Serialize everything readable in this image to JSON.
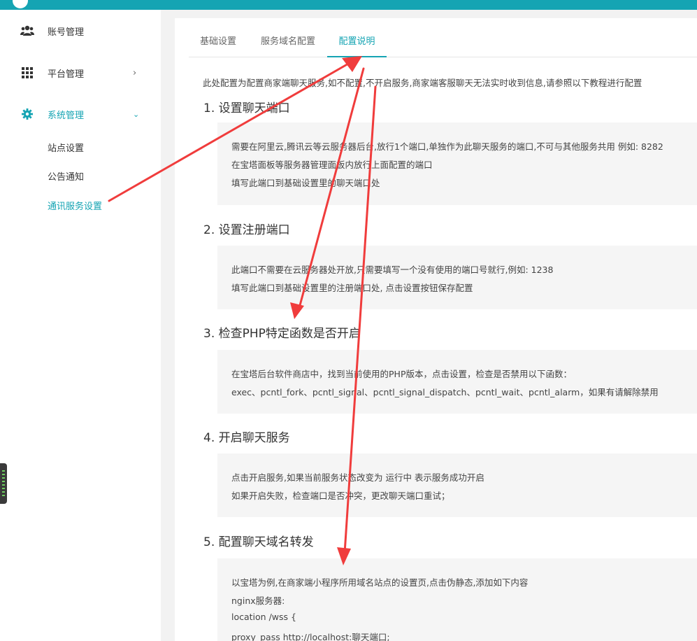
{
  "sidebar": {
    "items": [
      {
        "label": "账号管理",
        "icon": "users-icon"
      },
      {
        "label": "平台管理",
        "icon": "grid-icon",
        "chevron": "›"
      },
      {
        "label": "系统管理",
        "icon": "gear-icon",
        "chevron": "⌄"
      }
    ],
    "subitems": [
      "站点设置",
      "公告通知",
      "通讯服务设置"
    ]
  },
  "tabs": [
    "基础设置",
    "服务域名配置",
    "配置说明"
  ],
  "intro": "此处配置为配置商家端聊天服务,如不配置,不开启服务,商家端客服聊天无法实时收到信息,请参照以下教程进行配置",
  "sections": [
    {
      "title": "1. 设置聊天端口",
      "lines": [
        "需要在阿里云,腾讯云等云服务器后台,放行1个端口,单独作为此聊天服务的端口,不可与其他服务共用 例如: 8282",
        "在宝塔面板等服务器管理面板内放行上面配置的端口",
        "填写此端口到基础设置里的聊天端口处"
      ]
    },
    {
      "title": "2. 设置注册端口",
      "lines": [
        "此端口不需要在云服务器处开放,只需要填写一个没有使用的端口号就行,例如: 1238",
        "填写此端口到基础设置里的注册端口处, 点击设置按钮保存配置"
      ]
    },
    {
      "title": "3. 检查PHP特定函数是否开启",
      "lines": [
        "在宝塔后台软件商店中，找到当前使用的PHP版本，点击设置，检查是否禁用以下函数：",
        "exec、pcntl_fork、pcntl_signal、pcntl_signal_dispatch、pcntl_wait、pcntl_alarm，如果有请解除禁用"
      ]
    },
    {
      "title": "4. 开启聊天服务",
      "lines": [
        "点击开启服务,如果当前服务状态改变为 运行中 表示服务成功开启",
        "如果开启失败，检查端口是否冲突，更改聊天端口重试；"
      ]
    },
    {
      "title": "5. 配置聊天域名转发",
      "lines": [
        "以宝塔为例,在商家端小程序所用域名站点的设置页,点击伪静态,添加如下内容",
        "nginx服务器:",
        "location /wss {",
        "proxy_pass http://localhost:聊天端口;"
      ]
    }
  ],
  "colors": {
    "accent": "#15a4b3",
    "arrow": "#f03c3c"
  }
}
